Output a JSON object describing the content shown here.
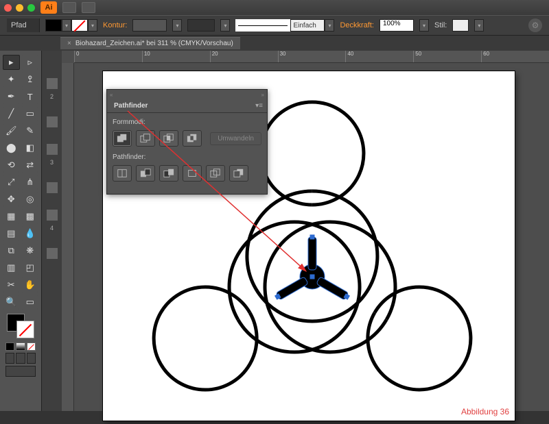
{
  "titlebar": {
    "app_badge": "Ai"
  },
  "controlbar": {
    "mode_label": "Pfad",
    "contour_label": "Kontur:",
    "stroke_style_label": "Einfach",
    "opacity_label": "Deckkraft:",
    "opacity_value": "100%",
    "style_label": "Stil:"
  },
  "tab": {
    "title": "Biohazard_Zeichen.ai* bei 311 % (CMYK/Vorschau)"
  },
  "ruler": [
    "0",
    "10",
    "20",
    "30",
    "40",
    "50",
    "60"
  ],
  "pathfinder": {
    "title": "Pathfinder",
    "section1": "Formmodi:",
    "expand": "Umwandeln",
    "section2": "Pathfinder:"
  },
  "left_numbers": [
    "2",
    "3",
    "4"
  ],
  "caption": "Abbildung  36"
}
